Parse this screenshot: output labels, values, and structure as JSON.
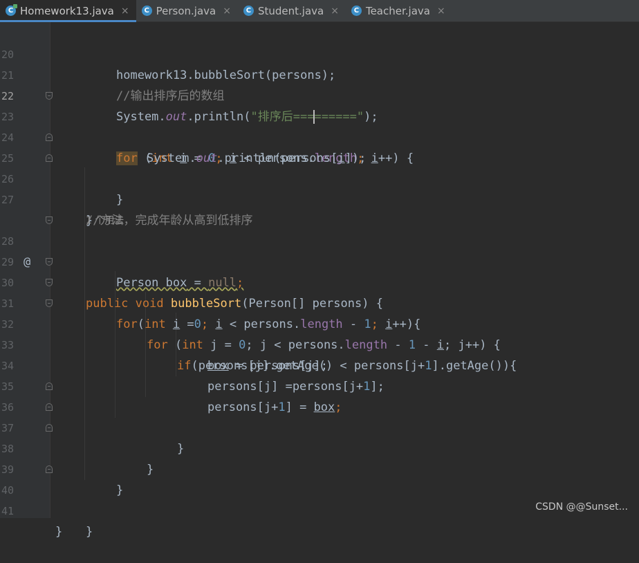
{
  "tabs": [
    {
      "label": "Homework13.java",
      "active": true
    },
    {
      "label": "Person.java",
      "active": false
    },
    {
      "label": "Student.java",
      "active": false
    },
    {
      "label": "Teacher.java",
      "active": false
    }
  ],
  "tab_close_glyph": "×",
  "tab_icon_letter": "C",
  "line_numbers": [
    "20",
    "21",
    "22",
    "23",
    "24",
    "25",
    "26",
    "27",
    "28",
    "29",
    "30",
    "31",
    "32",
    "33",
    "34",
    "35",
    "36",
    "37",
    "38",
    "39",
    "40",
    "41"
  ],
  "gutter_at": "@",
  "code": {
    "l20": "homework13.bubbleSort(persons);",
    "l21": "//输出排序后的数组",
    "l22a": "System.",
    "l22b": "out",
    "l22c": ".println(",
    "l22d": "\"排序后===",
    "l22e": "======\"",
    "l22f": ");",
    "l23": [
      "for",
      " (",
      "int",
      " ",
      "i",
      " = ",
      "0",
      "; ",
      "i",
      " < persons.",
      "length",
      "; ",
      "i",
      "++) {"
    ],
    "l24": [
      "System.",
      "out",
      ".println(persons[",
      "i",
      "]);"
    ],
    "l25": "}",
    "l26": "}",
    "l27": "//方法，完成年龄从高到低排序",
    "usage": "1 个用法",
    "l28": [
      "public",
      " ",
      "void",
      " ",
      "bubbleSort",
      "(Person[] persons) {"
    ],
    "l29": [
      "Person ",
      "box",
      " = ",
      "null",
      ";"
    ],
    "l30": [
      "for",
      "(",
      "int",
      " ",
      "i",
      " =",
      "0",
      "; ",
      "i",
      " < persons.",
      "length",
      " - ",
      "1",
      "; ",
      "i",
      "++){"
    ],
    "l31": [
      "for",
      " (",
      "int",
      " j = ",
      "0",
      "; j < persons.",
      "length",
      " - ",
      "1",
      " - ",
      "i",
      "; j++) {"
    ],
    "l32": [
      "if",
      "(persons[j].getAge() < persons[j+",
      "1",
      "].getAge()){"
    ],
    "l33": [
      "box",
      " = persons[j];"
    ],
    "l34": [
      "persons[j] =persons[j+",
      "1",
      "];"
    ],
    "l35": [
      "persons[j+",
      "1",
      "] = ",
      "box",
      ";"
    ],
    "l36": "}",
    "l37": "}",
    "l38": "}",
    "l40": "}",
    "l41": "}"
  },
  "watermark": "CSDN @@Sunset...",
  "colors": {
    "keyword": "#cc7832",
    "number": "#6897bb",
    "string": "#6a8759",
    "comment": "#808080",
    "field": "#9876aa",
    "method": "#ffc66d",
    "default": "#a9b7c6",
    "background": "#2b2b2b"
  }
}
